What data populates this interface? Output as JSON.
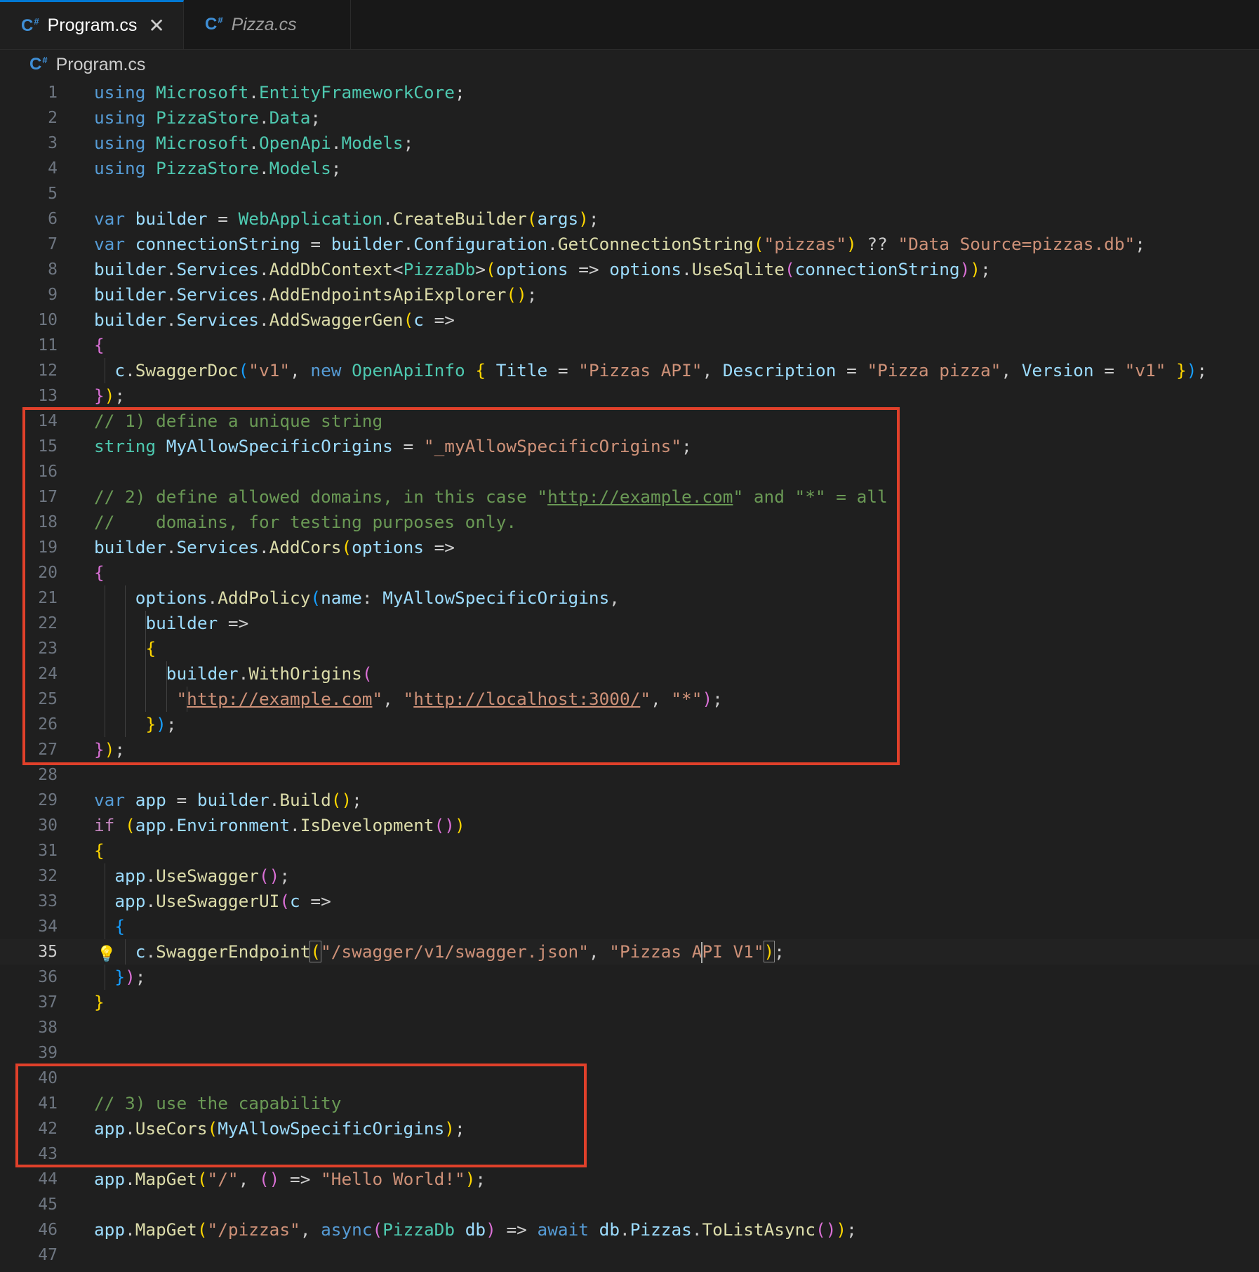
{
  "tabs": [
    {
      "label": "Program.cs",
      "icon": "csharp-file-icon",
      "active": true,
      "close_glyph": "✕"
    },
    {
      "label": "Pizza.cs",
      "icon": "csharp-file-icon",
      "active": false
    }
  ],
  "icon_glyph": "C",
  "breadcrumb": "Program.cs",
  "current_line": 35,
  "highlight_color": "#e0402a",
  "lines": [
    {
      "n": "1",
      "code": "<span class=\"kw\">using</span> <span class=\"ty\">Microsoft</span>.<span class=\"ty\">EntityFrameworkCore</span>;"
    },
    {
      "n": "2",
      "code": "<span class=\"kw\">using</span> <span class=\"ty\">PizzaStore</span>.<span class=\"ty\">Data</span>;"
    },
    {
      "n": "3",
      "code": "<span class=\"kw\">using</span> <span class=\"ty\">Microsoft</span>.<span class=\"ty\">OpenApi</span>.<span class=\"ty\">Models</span>;"
    },
    {
      "n": "4",
      "code": "<span class=\"kw\">using</span> <span class=\"ty\">PizzaStore</span>.<span class=\"ty\">Models</span>;"
    },
    {
      "n": "5",
      "code": ""
    },
    {
      "n": "6",
      "code": "<span class=\"kw\">var</span> <span class=\"va\">builder</span> = <span class=\"ty\">WebApplication</span>.<span class=\"fn\">CreateBuilder</span><span class=\"b1\">(</span><span class=\"va\">args</span><span class=\"b1\">)</span>;"
    },
    {
      "n": "7",
      "code": "<span class=\"kw\">var</span> <span class=\"va\">connectionString</span> = <span class=\"va\">builder</span>.<span class=\"va\">Configuration</span>.<span class=\"fn\">GetConnectionString</span><span class=\"b1\">(</span><span class=\"str\">\"pizzas\"</span><span class=\"b1\">)</span> ?? <span class=\"str\">\"Data Source=pizzas.db\"</span>;"
    },
    {
      "n": "8",
      "code": "<span class=\"va\">builder</span>.<span class=\"va\">Services</span>.<span class=\"fn\">AddDbContext</span>&lt;<span class=\"ty\">PizzaDb</span>&gt;<span class=\"b1\">(</span><span class=\"va\">options</span> =&gt; <span class=\"va\">options</span>.<span class=\"fn\">UseSqlite</span><span class=\"b2\">(</span><span class=\"va\">connectionString</span><span class=\"b2\">)</span><span class=\"b1\">)</span>;"
    },
    {
      "n": "9",
      "code": "<span class=\"va\">builder</span>.<span class=\"va\">Services</span>.<span class=\"fn\">AddEndpointsApiExplorer</span><span class=\"b1\">()</span>;"
    },
    {
      "n": "10",
      "code": "<span class=\"va\">builder</span>.<span class=\"va\">Services</span>.<span class=\"fn\">AddSwaggerGen</span><span class=\"b1\">(</span><span class=\"va\">c</span> =&gt;"
    },
    {
      "n": "11",
      "code": "<span class=\"b2\">{</span>"
    },
    {
      "n": "12",
      "code": "  <span class=\"va\">c</span>.<span class=\"fn\">SwaggerDoc</span><span class=\"b3\">(</span><span class=\"str\">\"v1\"</span>, <span class=\"kw\">new</span> <span class=\"ty\">OpenApiInfo</span> <span class=\"b1\">{</span> <span class=\"va\">Title</span> = <span class=\"str\">\"Pizzas API\"</span>, <span class=\"va\">Description</span> = <span class=\"str\">\"Pizza pizza\"</span>, <span class=\"va\">Version</span> = <span class=\"str\">\"v1\"</span> <span class=\"b1\">}</span><span class=\"b3\">)</span>;",
      "guides": [
        1
      ]
    },
    {
      "n": "13",
      "code": "<span class=\"b2\">}</span><span class=\"b1\">)</span>;"
    },
    {
      "n": "14",
      "code": "<span class=\"cm\">// 1) define a unique string</span>"
    },
    {
      "n": "15",
      "code": "<span class=\"ty\">string</span> <span class=\"va\">MyAllowSpecificOrigins</span> = <span class=\"str\">\"_myAllowSpecificOrigins\"</span>;"
    },
    {
      "n": "16",
      "code": ""
    },
    {
      "n": "17",
      "code": "<span class=\"cm\">// 2) define allowed domains, in this case \"<span class=\"u\">http://example.com</span>\" and \"*\" = all</span>"
    },
    {
      "n": "18",
      "code": "<span class=\"cm\">//    domains, for testing purposes only.</span>"
    },
    {
      "n": "19",
      "code": "<span class=\"va\">builder</span>.<span class=\"va\">Services</span>.<span class=\"fn\">AddCors</span><span class=\"b1\">(</span><span class=\"va\">options</span> =&gt;"
    },
    {
      "n": "20",
      "code": "<span class=\"b2\">{</span>"
    },
    {
      "n": "21",
      "code": "    <span class=\"va\">options</span>.<span class=\"fn\">AddPolicy</span><span class=\"b3\">(</span><span class=\"va\">name</span>: <span class=\"va\">MyAllowSpecificOrigins</span>,",
      "guides": [
        1,
        3
      ]
    },
    {
      "n": "22",
      "code": "     <span class=\"va\">builder</span> =&gt;",
      "guides": [
        1,
        3,
        5
      ]
    },
    {
      "n": "23",
      "code": "     <span class=\"b1\">{</span>",
      "guides": [
        1,
        3,
        5
      ]
    },
    {
      "n": "24",
      "code": "       <span class=\"va\">builder</span>.<span class=\"fn\">WithOrigins</span><span class=\"b2\">(</span>",
      "guides": [
        1,
        3,
        5,
        7
      ]
    },
    {
      "n": "25",
      "code": "        <span class=\"str\">\"<span class=\"u\">http://example.com</span>\"</span>, <span class=\"str\">\"<span class=\"u\">http://localhost:3000/</span>\"</span>, <span class=\"str\">\"*\"</span><span class=\"b2\">)</span>;",
      "guides": [
        1,
        3,
        5,
        7,
        9
      ]
    },
    {
      "n": "26",
      "code": "     <span class=\"b1\">}</span><span class=\"b3\">)</span>;",
      "guides": [
        1,
        3
      ]
    },
    {
      "n": "27",
      "code": "<span class=\"b2\">}</span><span class=\"b1\">)</span>;"
    },
    {
      "n": "28",
      "code": ""
    },
    {
      "n": "29",
      "code": "<span class=\"kw\">var</span> <span class=\"va\">app</span> = <span class=\"va\">builder</span>.<span class=\"fn\">Build</span><span class=\"b1\">()</span>;"
    },
    {
      "n": "30",
      "code": "<span class=\"ctl\">if</span> <span class=\"b1\">(</span><span class=\"va\">app</span>.<span class=\"va\">Environment</span>.<span class=\"fn\">IsDevelopment</span><span class=\"b2\">()</span><span class=\"b1\">)</span>"
    },
    {
      "n": "31",
      "code": "<span class=\"b1\">{</span>"
    },
    {
      "n": "32",
      "code": "  <span class=\"va\">app</span>.<span class=\"fn\">UseSwagger</span><span class=\"b2\">()</span>;",
      "guides": [
        1
      ]
    },
    {
      "n": "33",
      "code": "  <span class=\"va\">app</span>.<span class=\"fn\">UseSwaggerUI</span><span class=\"b2\">(</span><span class=\"va\">c</span> =&gt;",
      "guides": [
        1
      ]
    },
    {
      "n": "34",
      "code": "  <span class=\"b3\">{</span>",
      "guides": [
        1
      ]
    },
    {
      "n": "35",
      "code": "    <span class=\"va\">c</span>.<span class=\"fn\">SwaggerEndpoint</span><span class=\"b1 bm\">(</span><span class=\"str\">\"/swagger/v1/swagger.json\"</span>, <span class=\"str\">\"Pizzas A<span class=\"cursor\"></span>PI V1\"</span><span class=\"b1 bm\">)</span>;",
      "guides": [
        3
      ],
      "bulb": true
    },
    {
      "n": "36",
      "code": "  <span class=\"b3\">}</span><span class=\"b2\">)</span>;",
      "guides": [
        1
      ]
    },
    {
      "n": "37",
      "code": "<span class=\"b1\">}</span>"
    },
    {
      "n": "38",
      "code": ""
    },
    {
      "n": "39",
      "code": ""
    },
    {
      "n": "40",
      "code": ""
    },
    {
      "n": "41",
      "code": "<span class=\"cm\">// 3) use the capability</span>"
    },
    {
      "n": "42",
      "code": "<span class=\"va\">app</span>.<span class=\"fn\">UseCors</span><span class=\"b1\">(</span><span class=\"va\">MyAllowSpecificOrigins</span><span class=\"b1\">)</span>;"
    },
    {
      "n": "43",
      "code": ""
    },
    {
      "n": "44",
      "code": "<span class=\"va\">app</span>.<span class=\"fn\">MapGet</span><span class=\"b1\">(</span><span class=\"str\">\"/\"</span>, <span class=\"b2\">()</span> =&gt; <span class=\"str\">\"Hello World!\"</span><span class=\"b1\">)</span>;"
    },
    {
      "n": "45",
      "code": ""
    },
    {
      "n": "46",
      "code": "<span class=\"va\">app</span>.<span class=\"fn\">MapGet</span><span class=\"b1\">(</span><span class=\"str\">\"/pizzas\"</span>, <span class=\"kw\">async</span><span class=\"b2\">(</span><span class=\"ty\">PizzaDb</span> <span class=\"va\">db</span><span class=\"b2\">)</span> =&gt; <span class=\"kw\">await</span> <span class=\"va\">db</span>.<span class=\"va\">Pizzas</span>.<span class=\"fn\">ToListAsync</span><span class=\"b2\">()</span><span class=\"b1\">)</span>;"
    },
    {
      "n": "47",
      "code": ""
    }
  ]
}
